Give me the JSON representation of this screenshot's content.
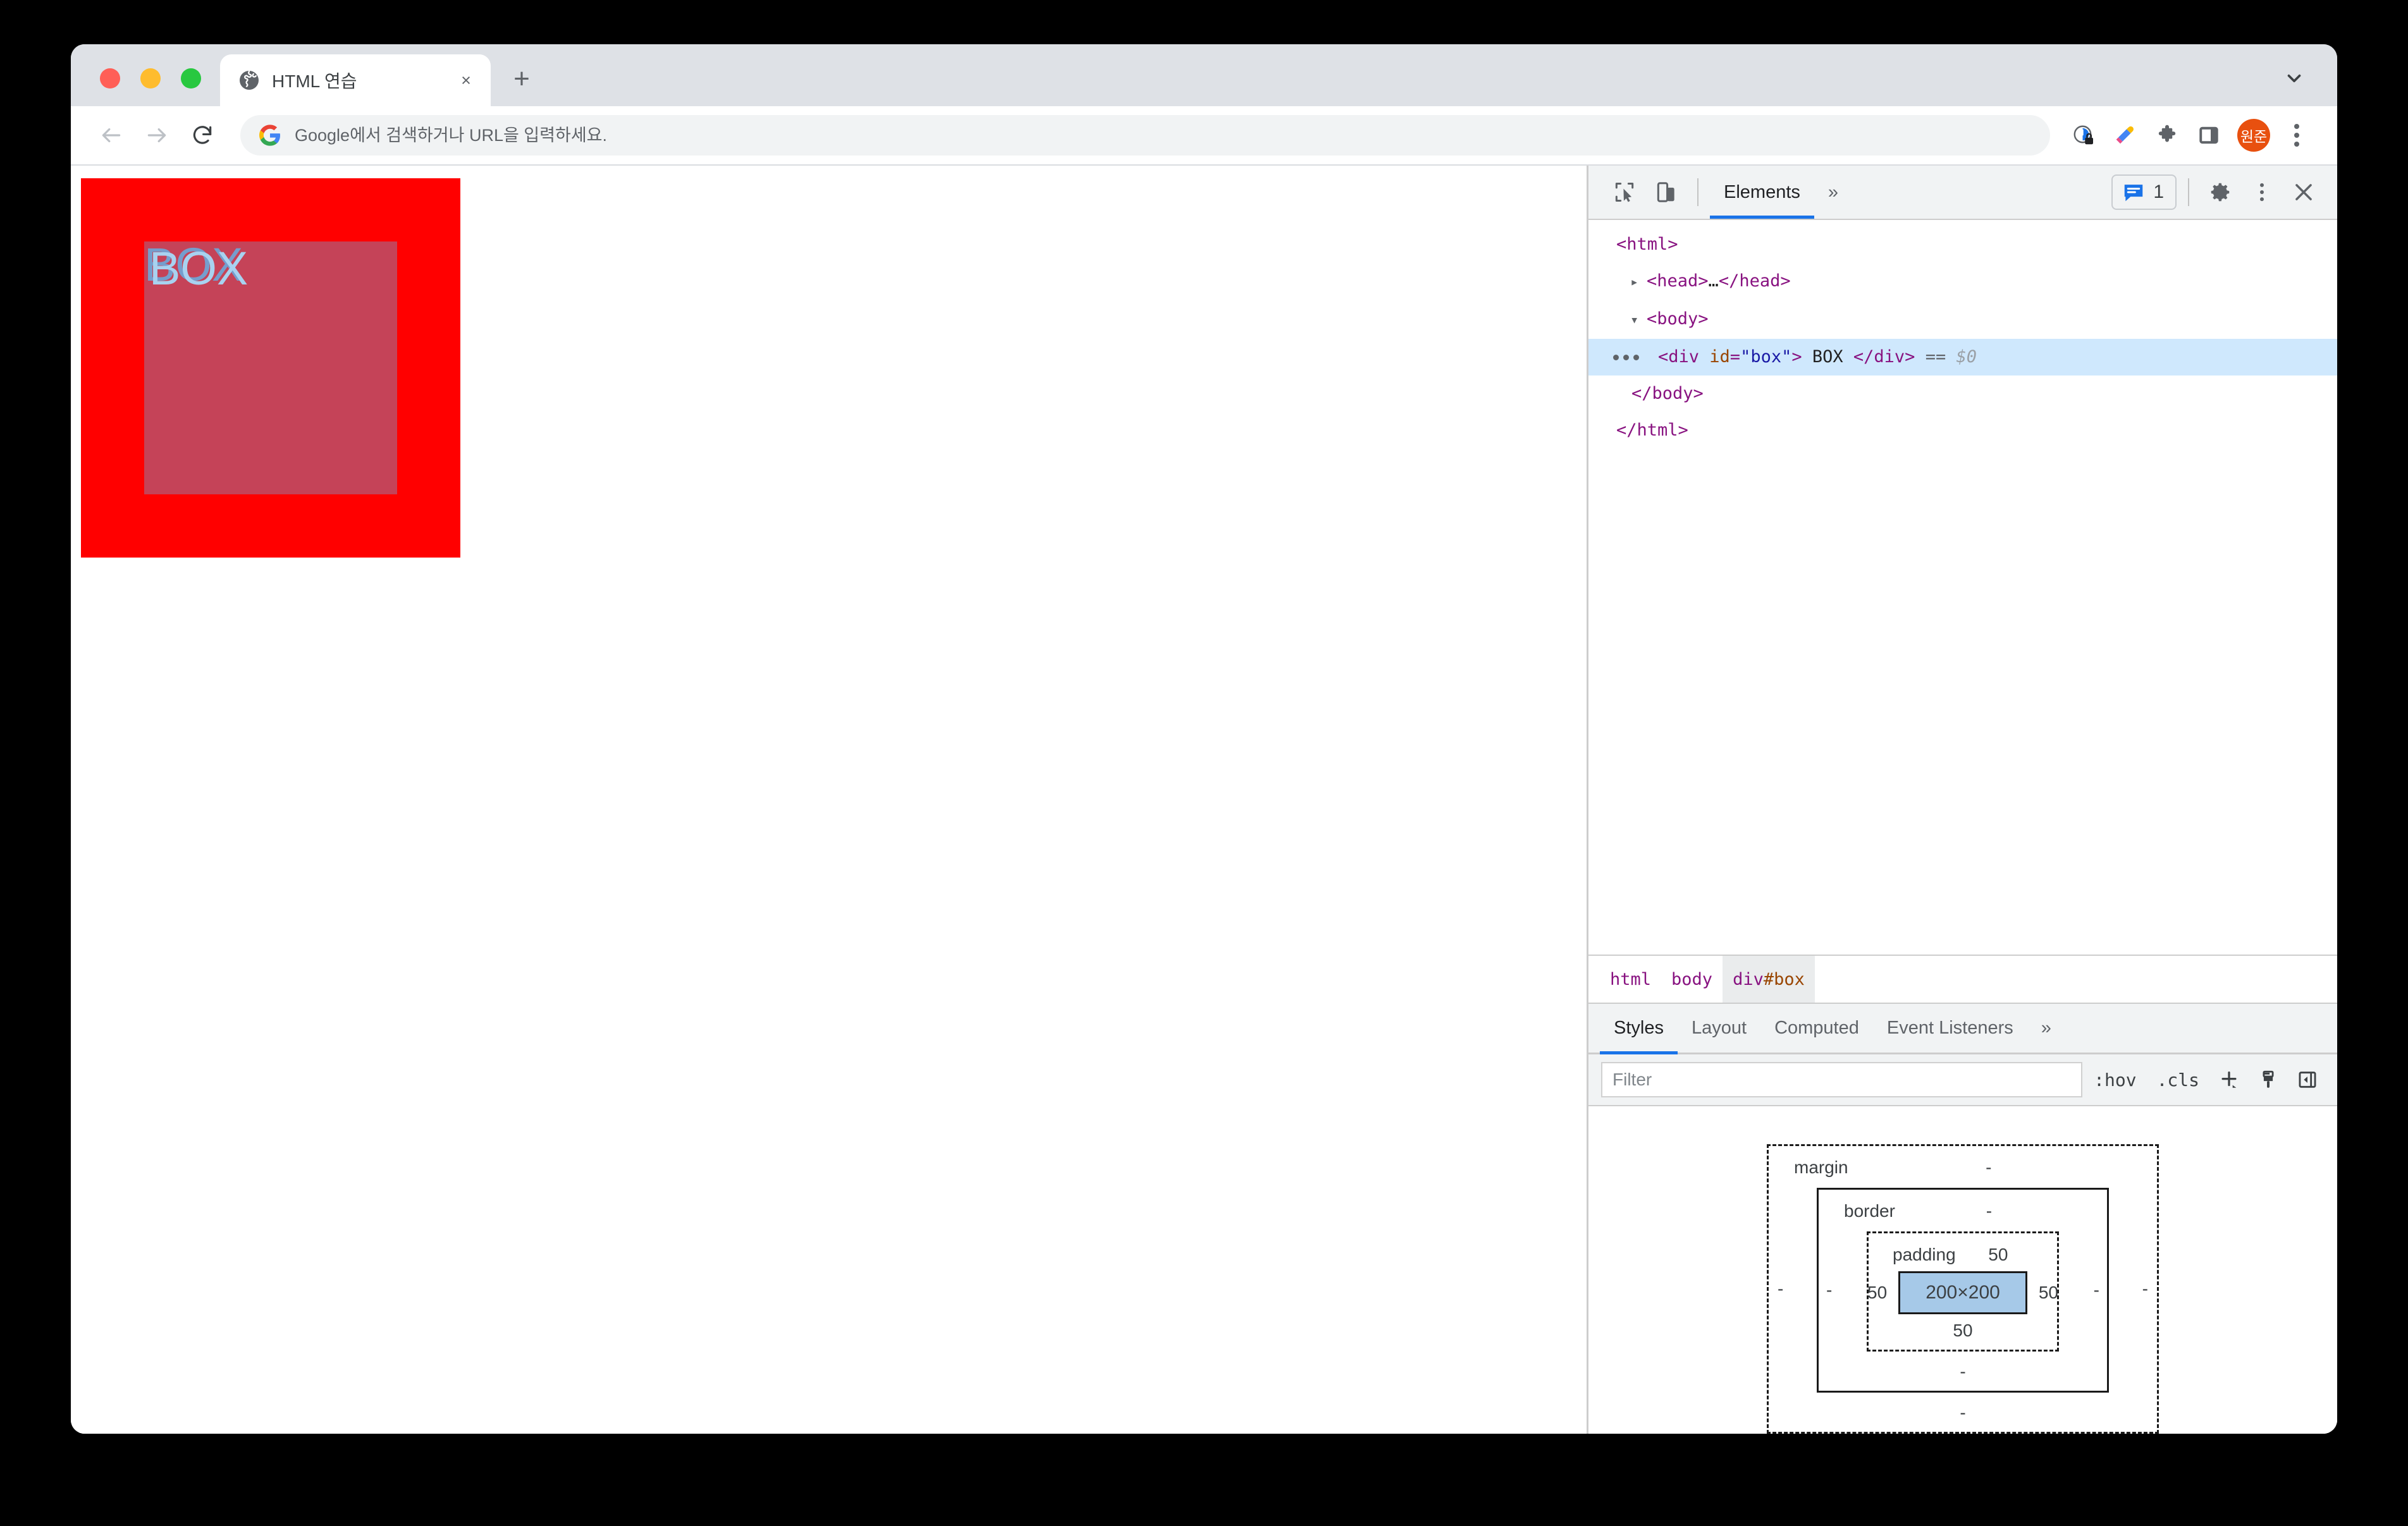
{
  "window": {
    "traffic_lights": [
      "close",
      "minimize",
      "maximize"
    ]
  },
  "tab_strip": {
    "tab": {
      "title": "HTML 연습",
      "favicon": "globe-icon",
      "close_label": "×"
    },
    "new_tab_label": "+",
    "tab_search": "chevron-down-icon"
  },
  "toolbar": {
    "back": "arrow-left-icon",
    "forward": "arrow-right-icon",
    "reload": "reload-icon",
    "omnibox": {
      "placeholder": "Google에서 검색하거나 URL을 입력하세요.",
      "value": "",
      "leading_icon": "google-g-icon"
    },
    "icons": [
      "privacy-lock-icon",
      "eyedropper-icon",
      "extensions-puzzle-icon",
      "side-panel-icon"
    ],
    "profile_initials": "원준",
    "menu": "kebab-menu-icon"
  },
  "page": {
    "box_text": "BOX",
    "box_background": "#ff0000",
    "content_highlight": "rgba(111,168,220,0.40)",
    "box_text_color": "#a8d2f0"
  },
  "devtools": {
    "toolbar": {
      "inspect": "inspect-cursor-icon",
      "device_toggle": "device-toolbar-icon",
      "panel_tabs": [
        {
          "label": "Elements",
          "active": true
        }
      ],
      "more_panels": "»",
      "console_count": "1",
      "console_icon": "message-bubble-icon",
      "settings": "gear-icon",
      "menu": "kebab-menu-icon",
      "close": "close-icon"
    },
    "dom_tree": {
      "rows": [
        {
          "indent": 0,
          "twisty": "",
          "segments": [
            {
              "t": "tag",
              "v": "<html>"
            }
          ]
        },
        {
          "indent": 1,
          "twisty": "▸",
          "segments": [
            {
              "t": "tag",
              "v": "<head>"
            },
            {
              "t": "txt",
              "v": "…"
            },
            {
              "t": "tag",
              "v": "</head>"
            }
          ]
        },
        {
          "indent": 1,
          "twisty": "▾",
          "segments": [
            {
              "t": "tag",
              "v": "<body>"
            }
          ]
        },
        {
          "indent": 2,
          "twisty": "",
          "selected": true,
          "segments": [
            {
              "t": "tag",
              "v": "<div "
            },
            {
              "t": "attr",
              "v": "id"
            },
            {
              "t": "tag",
              "v": "="
            },
            {
              "t": "val",
              "v": "\"box\""
            },
            {
              "t": "tag",
              "v": ">"
            },
            {
              "t": "txt",
              "v": " BOX "
            },
            {
              "t": "tag",
              "v": "</div>"
            },
            {
              "t": "eqeq",
              "v": " == "
            },
            {
              "t": "dollar",
              "v": "$0"
            }
          ]
        },
        {
          "indent": 1,
          "twisty": "",
          "segments": [
            {
              "t": "tag",
              "v": "</body>"
            }
          ]
        },
        {
          "indent": 0,
          "twisty": "",
          "segments": [
            {
              "t": "tag",
              "v": "</html>"
            }
          ]
        }
      ]
    },
    "breadcrumb": [
      {
        "tag": "html",
        "id": "",
        "selected": false
      },
      {
        "tag": "body",
        "id": "",
        "selected": false
      },
      {
        "tag": "div",
        "id": "#box",
        "selected": true
      }
    ],
    "styles": {
      "tabs": [
        {
          "label": "Styles",
          "active": true
        },
        {
          "label": "Layout",
          "active": false
        },
        {
          "label": "Computed",
          "active": false
        },
        {
          "label": "Event Listeners",
          "active": false
        }
      ],
      "more_tabs": "»",
      "filter_placeholder": "Filter",
      "filter_value": "",
      "hov_label": ":hov",
      "cls_label": ".cls",
      "new_rule_label": "+",
      "styles_icons": [
        "paintbrush-icon",
        "sidebar-toggle-icon"
      ]
    },
    "box_model": {
      "margin_label": "margin",
      "margin_top": "-",
      "margin_right": "-",
      "margin_bottom": "-",
      "margin_left": "-",
      "border_label": "border",
      "border_top": "-",
      "border_right": "-",
      "border_bottom": "-",
      "border_left": "-",
      "padding_label": "padding",
      "padding_top": "50",
      "padding_right": "50",
      "padding_bottom": "50",
      "padding_left": "50",
      "content_size": "200×200"
    }
  }
}
